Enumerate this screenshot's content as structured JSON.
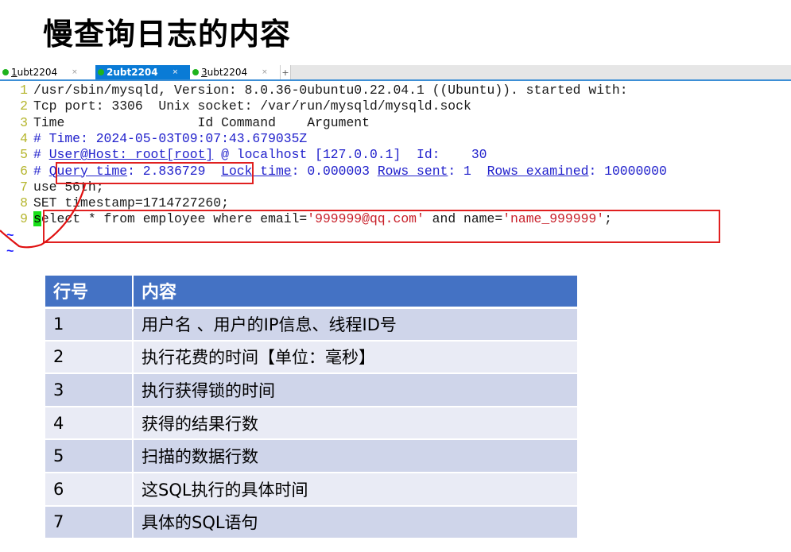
{
  "title": "慢查询日志的内容",
  "tabs": [
    {
      "num": "1",
      "label": " ubt2204",
      "active": false
    },
    {
      "num": "2",
      "label": " ubt2204",
      "active": true
    },
    {
      "num": "3",
      "label": " ubt2204",
      "active": false
    }
  ],
  "tab_close": "×",
  "tab_add": "+",
  "terminal": {
    "lines": [
      {
        "n": "1",
        "segments": [
          {
            "t": "/usr/sbin/mysqld, Version: 8.0.36-0ubuntu0.22.04.1 ((Ubuntu)). started with:",
            "c": "blk"
          }
        ]
      },
      {
        "n": "2",
        "segments": [
          {
            "t": "Tcp port: 3306  Unix socket: /var/run/mysqld/mysqld.sock",
            "c": "blk"
          }
        ]
      },
      {
        "n": "3",
        "segments": [
          {
            "t": "Time                 Id Command    Argument",
            "c": "blk"
          }
        ]
      },
      {
        "n": "4",
        "segments": [
          {
            "t": "# Time: 2024-05-03T09:07:43.679035Z",
            "c": "blu"
          }
        ]
      },
      {
        "n": "5",
        "segments": [
          {
            "t": "# ",
            "c": "blu"
          },
          {
            "t": "User@Host: root[root]",
            "c": "blu u"
          },
          {
            "t": " @ localhost [127.0.0.1]  Id:    30",
            "c": "blu"
          }
        ]
      },
      {
        "n": "6",
        "segments": [
          {
            "t": "# ",
            "c": "blu"
          },
          {
            "t": "Query_time",
            "c": "blu u"
          },
          {
            "t": ": 2.836729  ",
            "c": "blu"
          },
          {
            "t": "Lock_time",
            "c": "blu u"
          },
          {
            "t": ": 0.000003 ",
            "c": "blu"
          },
          {
            "t": "Rows_sent",
            "c": "blu u"
          },
          {
            "t": ": 1  ",
            "c": "blu"
          },
          {
            "t": "Rows_examined",
            "c": "blu u"
          },
          {
            "t": ": 10000000",
            "c": "blu"
          }
        ]
      },
      {
        "n": "7",
        "segments": [
          {
            "t": "use 56th;",
            "c": "blk"
          }
        ]
      },
      {
        "n": "8",
        "segments": [
          {
            "t": "SET timestamp=1714727260;",
            "c": "blk"
          }
        ]
      },
      {
        "n": "9",
        "segments": [
          {
            "t": "s",
            "c": "blk cursor"
          },
          {
            "t": "elect * from employee where email=",
            "c": "blk"
          },
          {
            "t": "'999999@qq.com'",
            "c": "red"
          },
          {
            "t": " and name=",
            "c": "blk"
          },
          {
            "t": "'name_999999'",
            "c": "red"
          },
          {
            "t": ";",
            "c": "blk"
          }
        ]
      }
    ],
    "tilde": "~"
  },
  "table": {
    "headers": [
      "行号",
      "内容"
    ],
    "rows": [
      [
        "1",
        "用户名 、用户的IP信息、线程ID号"
      ],
      [
        "2",
        "执行花费的时间【单位：毫秒】"
      ],
      [
        "3",
        "执行获得锁的时间"
      ],
      [
        "4",
        "获得的结果行数"
      ],
      [
        "5",
        "扫描的数据行数"
      ],
      [
        "6",
        "这SQL执行的具体时间"
      ],
      [
        "7",
        "具体的SQL语句"
      ]
    ]
  }
}
